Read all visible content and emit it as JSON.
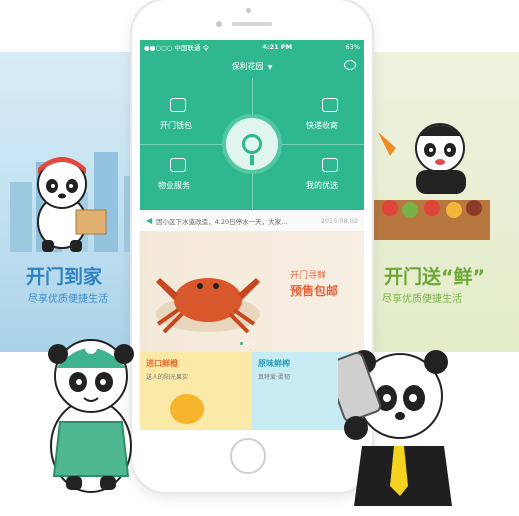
{
  "left_panel": {
    "title": "开门到家",
    "subtitle": "尽享优质便捷生活"
  },
  "right_panel": {
    "title": "开门送“鲜”",
    "subtitle": "尽享优质便捷生活"
  },
  "status_bar": {
    "carrier": "●●○○○ 中国联通 令",
    "time": "4:21 PM",
    "battery": "63%"
  },
  "app": {
    "community_name": "保利花园",
    "dropdown_icon": "chevron-down-icon",
    "chat_icon": "chat-icon"
  },
  "grid": [
    {
      "label": "开门钱包",
      "icon": "wallet-icon"
    },
    {
      "label": "快递收寄",
      "icon": "truck-icon"
    },
    {
      "label": "物业服务",
      "icon": "house-icon"
    },
    {
      "label": "我的优选",
      "icon": "favorites-icon"
    }
  ],
  "notice": {
    "text": "因小区下水道改造，4.20日停水一天，大家...",
    "date": "2015.08.02",
    "icon": "speaker-icon"
  },
  "banner": {
    "line1": "开门寻鲜",
    "line2": "预售包邮"
  },
  "promos": [
    {
      "title": "进口鲜橙",
      "subtitle": "送人的阳光果实"
    },
    {
      "title": "原味鲜榨",
      "subtitle": "真特爱·柔韧"
    }
  ],
  "colors": {
    "brand": "#2fb88f",
    "left_accent": "#2f82c2",
    "right_accent": "#6da737",
    "banner_accent": "#e6643b"
  }
}
